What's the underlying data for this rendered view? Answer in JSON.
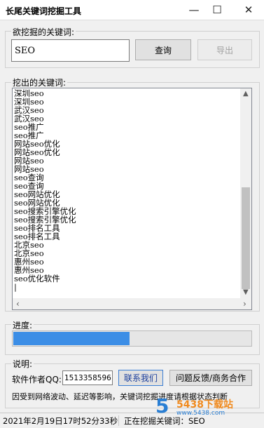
{
  "window": {
    "title": "长尾关键词挖掘工具",
    "minimize": "—",
    "maximize": "☐",
    "close": "✕"
  },
  "search": {
    "legend": "欲挖掘的关键词:",
    "value": "SEO",
    "query_button": "查询",
    "export_button": "导出"
  },
  "results": {
    "legend": "挖出的关键词:",
    "lines": [
      "深圳seo",
      "深圳seo",
      "武汉seo",
      "武汉seo",
      "seo推广",
      "seo推广",
      "网站seo优化",
      "网站seo优化",
      "网站seo",
      "网站seo",
      "seo查询",
      "seo查询",
      "seo网站优化",
      "seo网站优化",
      "seo搜索引擎优化",
      "seo搜索引擎优化",
      "seo排名工具",
      "seo排名工具",
      "北京seo",
      "北京seo",
      "惠州seo",
      "惠州seo",
      "seo优化软件",
      "|"
    ]
  },
  "progress": {
    "legend": "进度:",
    "fraction": 0.49
  },
  "info": {
    "legend": "说明:",
    "author_label": "软件作者QQ:",
    "qq": "1513358596",
    "contact_button": "联系我们",
    "feedback_button": "问题反馈/商务合作",
    "note": "因受到网络波动、延迟等影响，关键词挖掘进度请根据状态判断"
  },
  "status_bar": {
    "datetime": "2021年2月19日17时52分33秒",
    "state": "正在挖掘关键词：SEO"
  },
  "watermark": {
    "logo": "5",
    "text": "5438下载站",
    "url": "www.5438.com"
  },
  "colors": {
    "accent": "#3c8ee6",
    "link": "#1a3e9c",
    "watermark_orange": "#f08a1e",
    "watermark_blue": "#2a7fd4"
  }
}
